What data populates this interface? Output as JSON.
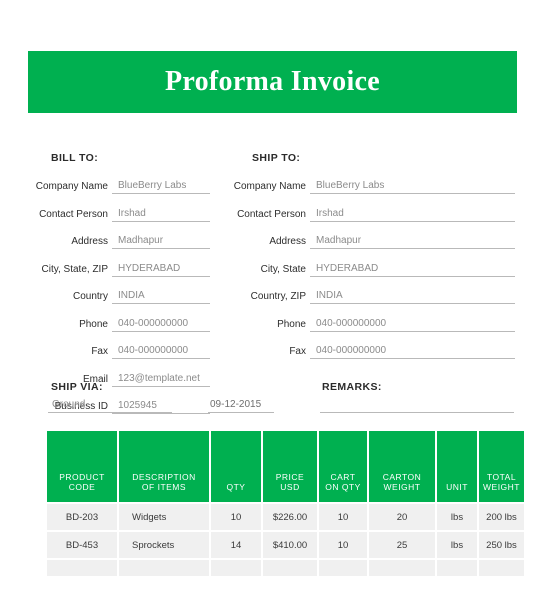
{
  "banner": {
    "title": "Proforma Invoice",
    "background_color": "#00b050",
    "text_color": "#ffffff"
  },
  "bill_to": {
    "heading": "BILL TO:",
    "fields": [
      {
        "label": "Company Name",
        "value": "BlueBerry Labs"
      },
      {
        "label": "Contact Person",
        "value": "Irshad"
      },
      {
        "label": "Address",
        "value": "Madhapur"
      },
      {
        "label": "City, State, ZIP",
        "value": "HYDERABAD"
      },
      {
        "label": "Country",
        "value": "INDIA"
      },
      {
        "label": "Phone",
        "value": "040-000000000"
      },
      {
        "label": "Fax",
        "value": "040-000000000"
      },
      {
        "label": "Email",
        "value": "123@template.net"
      },
      {
        "label": "Business ID",
        "value": "1025945"
      }
    ]
  },
  "ship_to": {
    "heading": "SHIP TO:",
    "fields": [
      {
        "label": "Company Name",
        "value": "BlueBerry Labs"
      },
      {
        "label": "Contact Person",
        "value": "Irshad"
      },
      {
        "label": "Address",
        "value": "Madhapur"
      },
      {
        "label": "City, State",
        "value": "HYDERABAD"
      },
      {
        "label": "Country, ZIP",
        "value": "INDIA"
      },
      {
        "label": "Phone",
        "value": "040-000000000"
      },
      {
        "label": "Fax",
        "value": "040-000000000"
      }
    ]
  },
  "ship_via": {
    "heading": "SHIP VIA:",
    "value": "Ground",
    "date": "09-12-2015"
  },
  "remarks": {
    "heading": "REMARKS:",
    "value": ""
  },
  "items_table": {
    "columns": [
      "PRODUCT CODE",
      "DESCRIPTION OF ITEMS",
      "QTY",
      "PRICE USD",
      "CART ON QTY",
      "CARTON WEIGHT",
      "UNIT",
      "TOTAL WEIGHT"
    ],
    "columns_lines": [
      [
        "PRODUCT",
        "CODE"
      ],
      [
        "DESCRIPTION",
        "OF ITEMS"
      ],
      [
        "",
        "QTY"
      ],
      [
        "PRICE",
        "USD"
      ],
      [
        "CART",
        "ON QTY"
      ],
      [
        "CARTON",
        "WEIGHT"
      ],
      [
        "",
        "UNIT"
      ],
      [
        "TOTAL",
        "WEIGHT"
      ]
    ],
    "rows": [
      {
        "product_code": "BD-203",
        "description": "Widgets",
        "qty": "10",
        "price_usd": "$226.00",
        "cart_on_qty": "10",
        "carton_weight": "20",
        "unit": "lbs",
        "total_weight": "200 lbs"
      },
      {
        "product_code": "BD-453",
        "description": "Sprockets",
        "qty": "14",
        "price_usd": "$410.00",
        "cart_on_qty": "10",
        "carton_weight": "25",
        "unit": "lbs",
        "total_weight": "250 lbs"
      },
      {
        "product_code": "",
        "description": "",
        "qty": "",
        "price_usd": "",
        "cart_on_qty": "",
        "carton_weight": "",
        "unit": "",
        "total_weight": ""
      }
    ]
  }
}
